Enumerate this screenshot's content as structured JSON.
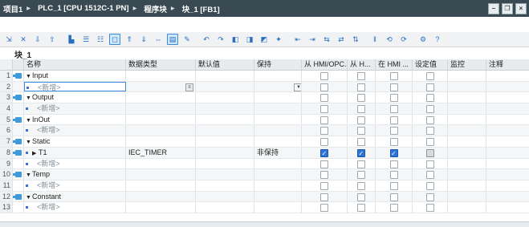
{
  "breadcrumb": [
    "项目1",
    "PLC_1 [CPU 1512C-1 PN]",
    "程序块",
    "块_1 [FB1]"
  ],
  "block_name": "块_1",
  "columns": {
    "name": "名称",
    "type": "数据类型",
    "default": "默认值",
    "retain": "保持",
    "hmi1": "从 HMI/OPC...",
    "hmi2": "从 H...",
    "hmi3": "在 HMI ...",
    "setpoint": "设定值",
    "monitor": "监控",
    "comment": "注释"
  },
  "new_placeholder": "<新增>",
  "rows": [
    {
      "num": "1",
      "name": "Input",
      "section": true
    },
    {
      "num": "2",
      "name": "<新增>",
      "new": true
    },
    {
      "num": "3",
      "name": "Output",
      "section": true
    },
    {
      "num": "4",
      "name": "<新增>",
      "new": true
    },
    {
      "num": "5",
      "name": "InOut",
      "section": true
    },
    {
      "num": "6",
      "name": "<新增>",
      "new": true
    },
    {
      "num": "7",
      "name": "Static",
      "section": true
    },
    {
      "num": "8",
      "name": "T1",
      "type": "IEC_TIMER",
      "retain": "非保持",
      "child": true
    },
    {
      "num": "9",
      "name": "<新增>",
      "new": true
    },
    {
      "num": "10",
      "name": "Temp",
      "section": true
    },
    {
      "num": "11",
      "name": "<新增>",
      "new": true
    },
    {
      "num": "12",
      "name": "Constant",
      "section": true
    },
    {
      "num": "13",
      "name": "<新增>",
      "new": true
    }
  ],
  "toolbar_icons": [
    "insert-row-icon",
    "delete-row-icon",
    "insert-line-icon",
    "add-line-icon",
    "group-icon",
    "list-icon",
    "list-detail-icon",
    "list-expand-icon",
    "comment-icon",
    "move-up-icon",
    "move-down-icon",
    "cross-ref-icon",
    "display-icon",
    "view-icon",
    "sort-icon",
    "filter-icon",
    "monitor-icon",
    "watch-icon",
    "load-icon",
    "save-icon",
    "compare-icon",
    "copy-icon",
    "close-icon",
    "expand-icon",
    "pause-icon",
    "refresh-icon",
    "download-icon",
    "upload-icon",
    "settings-icon",
    "help-icon"
  ]
}
